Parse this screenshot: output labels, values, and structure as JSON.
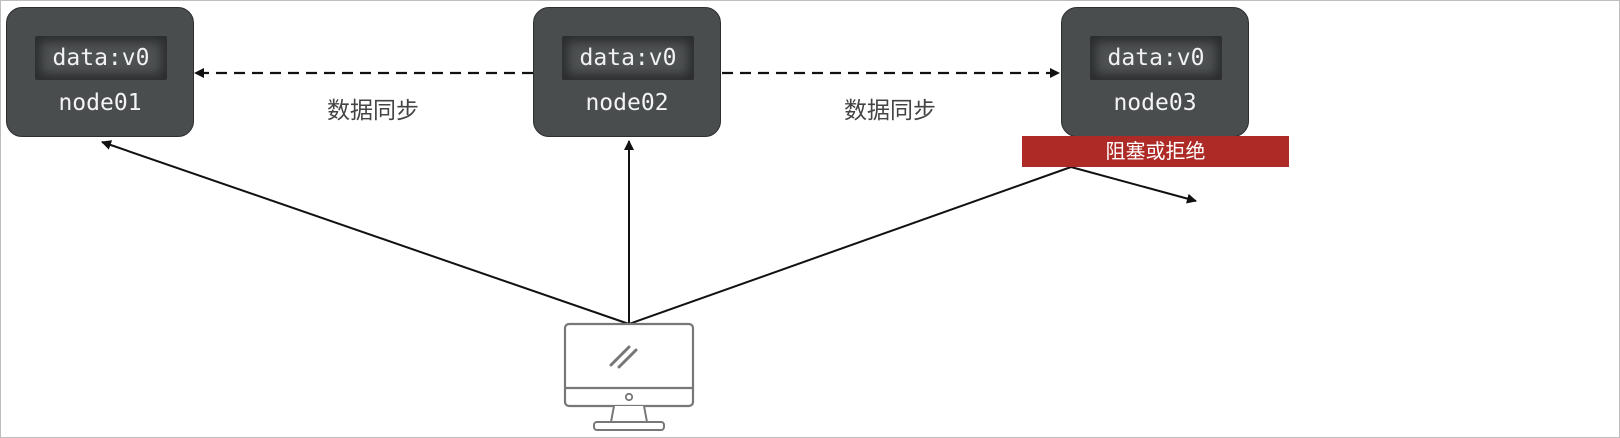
{
  "nodes": [
    {
      "id": "node01",
      "data": "data:v0",
      "label": "node01"
    },
    {
      "id": "node02",
      "data": "data:v0",
      "label": "node02"
    },
    {
      "id": "node03",
      "data": "data:v0",
      "label": "node03"
    }
  ],
  "sync_labels": [
    "数据同步",
    "数据同步"
  ],
  "blocked_label": "阻塞或拒绝",
  "colors": {
    "node_fill": "#4a4d4e",
    "banner": "#ad2a26",
    "line": "#111111",
    "computer_stroke": "#777777"
  },
  "icons": {
    "client": "desktop-computer-icon"
  }
}
